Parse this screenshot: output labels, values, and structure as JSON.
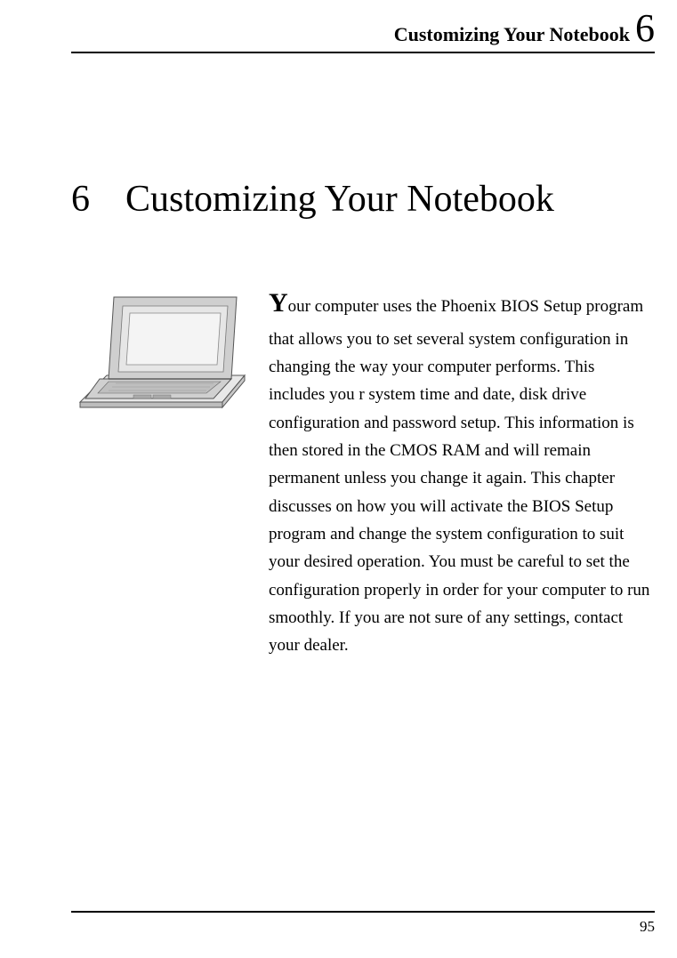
{
  "header": {
    "title": "Customizing Your Notebook",
    "chapter_num": "6"
  },
  "chapter": {
    "num": "6",
    "title": "Customizing Your Notebook"
  },
  "body": {
    "dropcap": "Y",
    "text": "our computer uses the Phoenix BIOS Setup program that allows you to set several system configuration in changing the way your computer performs. This includes you r system time and date, disk drive configuration and password setup. This information is then stored in the CMOS RAM and will remain permanent unless you change it again. This chapter discusses on how you will activate the BIOS Setup program and change the system configuration to suit your desired operation. You must be careful to set the configuration properly in order for your computer to run smoothly. If you are not sure of any settings, contact your dealer."
  },
  "footer": {
    "page_num": "95"
  }
}
